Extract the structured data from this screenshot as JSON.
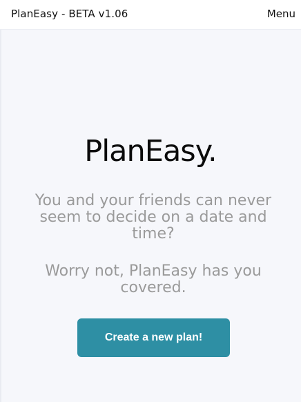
{
  "header": {
    "brand": "PlanEasy - BETA v1.06",
    "menu_label": "Menu"
  },
  "hero": {
    "title": "PlanEasy.",
    "line1": "You and your friends can never seem to decide on a date and time?",
    "line2": "Worry not, PlanEasy has you covered.",
    "cta_label": "Create a new plan!"
  },
  "colors": {
    "background": "#f6f7fb",
    "topbar": "#ffffff",
    "accent": "#2e8fa4",
    "muted_text": "#9a9a9a",
    "text": "#111111"
  }
}
